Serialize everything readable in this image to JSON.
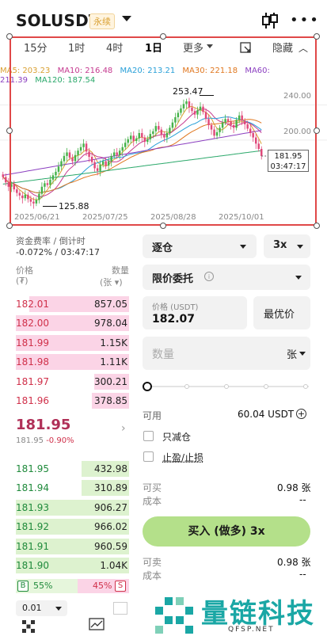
{
  "header": {
    "symbol": "SOLUSDT",
    "badge": "永续",
    "icons": [
      "chevron-down-icon",
      "candlestick-icon",
      "more-icon"
    ]
  },
  "chart": {
    "timeframes": [
      "15分",
      "1时",
      "4时",
      "1日",
      "更多"
    ],
    "active_timeframe": "1日",
    "hide_label": "隐藏",
    "ma_row1": [
      {
        "label": "MA5: 203.23",
        "color": "#d9a032"
      },
      {
        "label": "MA10: 216.48",
        "color": "#c5398f"
      },
      {
        "label": "MA20: 213.21",
        "color": "#29a0d8"
      },
      {
        "label": "MA30: 221.18",
        "color": "#e0771f"
      },
      {
        "label": "MA60:",
        "color": "#8b3fc0"
      }
    ],
    "ma_row2": [
      {
        "label": "211.39",
        "color": "#8b3fc0"
      },
      {
        "label": "MA120: 187.54",
        "color": "#2aa86a"
      }
    ],
    "y_ticks": [
      "240.00",
      "200.00"
    ],
    "x_ticks": [
      "2025/06/21",
      "2025/07/25",
      "2025/08/28",
      "2025/10/01"
    ],
    "high_label": "253.47",
    "low_label": "125.88",
    "current_price": "181.95",
    "countdown": "03:47:17"
  },
  "chart_data": {
    "type": "candlestick",
    "title": "",
    "x_ticks": [
      "2025/06/21",
      "2025/07/25",
      "2025/08/28",
      "2025/10/01"
    ],
    "y_ticks": [
      200,
      240
    ],
    "high": 253.47,
    "low": 125.88,
    "last": 181.95,
    "ma": {
      "MA5": 203.23,
      "MA10": 216.48,
      "MA20": 213.21,
      "MA30": 221.18,
      "MA60": 211.39,
      "MA120": 187.54
    },
    "closes": [
      158,
      152,
      147,
      150,
      144,
      140,
      137,
      134,
      138,
      133,
      130,
      128,
      132,
      139,
      147,
      151,
      149,
      155,
      160,
      164,
      170,
      176,
      182,
      186,
      180,
      176,
      183,
      188,
      192,
      196,
      187,
      181,
      175,
      168,
      165,
      172,
      176,
      171,
      176,
      182,
      186,
      183,
      188,
      192,
      197,
      201,
      205,
      199,
      202,
      208,
      203,
      198,
      201,
      207,
      210,
      216,
      212,
      206,
      203,
      208,
      214,
      220,
      226,
      231,
      236,
      241,
      244,
      237,
      233,
      229,
      234,
      238,
      232,
      224,
      217,
      212,
      205,
      209,
      214,
      220,
      224,
      221,
      217,
      214,
      223,
      228,
      222,
      218,
      213,
      208,
      203,
      196,
      190,
      181.95
    ]
  },
  "funding": {
    "label": "资金费率 / 倒计时",
    "value": "-0.072% / 03:47:17"
  },
  "orderbook": {
    "price_header": "价格",
    "price_unit": "(₮)",
    "qty_header": "数量",
    "qty_unit": "(张",
    "asks": [
      {
        "price": "182.01",
        "qty": "857.05",
        "depth": 0.88
      },
      {
        "price": "182.00",
        "qty": "978.04",
        "depth": 1.0
      },
      {
        "price": "181.99",
        "qty": "1.15K",
        "depth": 1.0
      },
      {
        "price": "181.98",
        "qty": "1.11K",
        "depth": 1.0
      },
      {
        "price": "181.97",
        "qty": "300.21",
        "depth": 0.31
      },
      {
        "price": "181.96",
        "qty": "378.85",
        "depth": 0.33
      }
    ],
    "last_price": "181.95",
    "last_price_sub": "181.95",
    "last_change": "-0.90%",
    "bids": [
      {
        "price": "181.95",
        "qty": "432.98",
        "depth": 0.42
      },
      {
        "price": "181.94",
        "qty": "310.89",
        "depth": 0.42
      },
      {
        "price": "181.93",
        "qty": "906.27",
        "depth": 1.0
      },
      {
        "price": "181.92",
        "qty": "966.02",
        "depth": 1.0
      },
      {
        "price": "181.91",
        "qty": "960.59",
        "depth": 1.0
      },
      {
        "price": "181.90",
        "qty": "1.04K",
        "depth": 1.0
      }
    ],
    "buy_ratio_tag": "B",
    "buy_ratio": "55%",
    "sell_ratio": "45%",
    "sell_ratio_tag": "S",
    "precision": "0.01"
  },
  "form": {
    "margin_mode": "逐仓",
    "leverage": "3x",
    "order_type": "限价委托",
    "price_label": "价格 (USDT)",
    "price_value": "182.07",
    "best_price": "最优价",
    "qty_placeholder": "数量",
    "qty_unit": "张",
    "slider_value": 0,
    "available_label": "可用",
    "available_value": "60.04 USDT",
    "reduce_only": "只减仓",
    "tp_sl": "止盈/止损",
    "can_buy_label": "可买",
    "can_buy_value": "0.98 张",
    "cost_label": "成本",
    "cost_value": "--",
    "buy_button": "买入 (做多) 3x",
    "can_sell_label": "可卖",
    "can_sell_value": "0.98 张",
    "cost2_label": "成本",
    "cost2_value": "--"
  },
  "watermark": {
    "text": "量链科技",
    "sub": "QFSP.NET"
  }
}
